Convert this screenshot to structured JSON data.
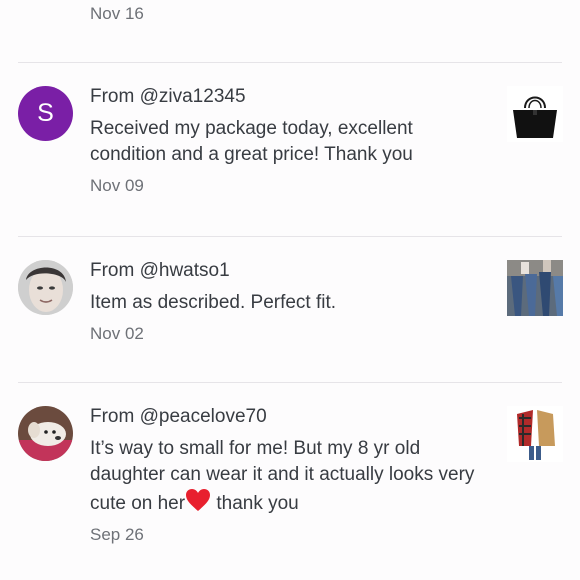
{
  "top": {
    "date": "Nov 16"
  },
  "reviews": [
    {
      "avatar_letter": "S",
      "from": "From @ziva12345",
      "message": "Received my package today, excellent condition and a great price! Thank you",
      "date": "Nov 09",
      "product_icon": "black-tote-bag"
    },
    {
      "from": "From @hwatso1",
      "message": "Item as described. Perfect fit.",
      "date": "Nov 02",
      "product_icon": "jeans-outfit"
    },
    {
      "from": "From @peacelove70",
      "message_before": "It’s way to small for me! But my 8 yr old daughter can wear it and it actually looks very cute on her",
      "message_after": " thank you",
      "date": "Sep 26",
      "product_icon": "plaid-jacket"
    }
  ],
  "colors": {
    "avatar_purple": "#7a1fa6",
    "divider": "#e6e4e8",
    "text": "#383c42",
    "muted": "#6e7177"
  }
}
